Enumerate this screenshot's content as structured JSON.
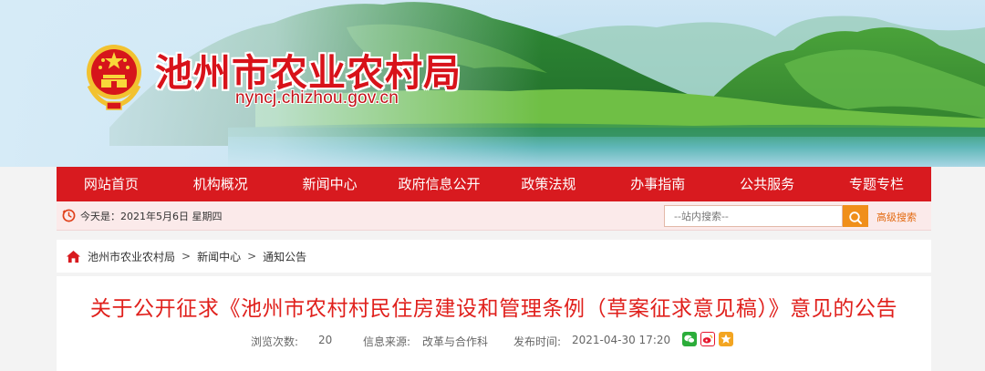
{
  "header": {
    "site_title": "池州市农业农村局",
    "site_domain": "nyncj.chizhou.gov.cn"
  },
  "nav": {
    "items": [
      "网站首页",
      "机构概况",
      "新闻中心",
      "政府信息公开",
      "政策法规",
      "办事指南",
      "公共服务",
      "专题专栏"
    ]
  },
  "infobar": {
    "date_text": "今天是：2021年5月6日 星期四",
    "search_placeholder": "--站内搜索--",
    "advanced_search": "高级搜索"
  },
  "breadcrumb": {
    "items": [
      "池州市农业农村局",
      "新闻中心",
      "通知公告"
    ],
    "separator": ">"
  },
  "article": {
    "title": "关于公开征求《池州市农村村民住房建设和管理条例（草案征求意见稿）》意见的公告",
    "views_label": "浏览次数:",
    "views": "20",
    "source_label": "信息来源:",
    "source": "改革与合作科",
    "time_label": "发布时间:",
    "time": "2021-04-30 17:20"
  },
  "colors": {
    "brand_red": "#d81a1f",
    "title_red": "#e0201c",
    "search_orange": "#f08f1a",
    "wechat_green": "#2bad3a",
    "weibo_red": "#e6162d",
    "fav_orange": "#f3a521"
  },
  "icons": {
    "emblem": "national-emblem-icon",
    "clock": "clock-icon",
    "search": "search-icon",
    "home": "home-icon",
    "wechat": "wechat-icon",
    "weibo": "weibo-icon",
    "favorite": "star-icon"
  }
}
